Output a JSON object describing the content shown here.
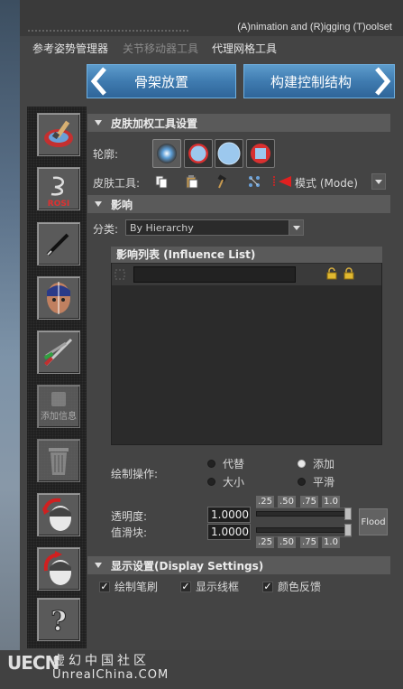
{
  "app": {
    "title": "(A)nimation and (R)igging (T)oolset"
  },
  "menu": {
    "items": [
      {
        "label": "参考姿势管理器",
        "enabled": true
      },
      {
        "label": "关节移动器工具",
        "enabled": false
      },
      {
        "label": "代理网格工具",
        "enabled": true
      }
    ]
  },
  "nav": {
    "prev_label": "骨架放置",
    "next_label": "构建控制结构",
    "accent": "#4a8ac0"
  },
  "tools": [
    {
      "icon": "skin-paint-icon",
      "caption": ""
    },
    {
      "icon": "rosi-icon",
      "caption": ""
    },
    {
      "icon": "pencil-icon",
      "caption": ""
    },
    {
      "icon": "mirror-face-icon",
      "caption": ""
    },
    {
      "icon": "scissors-icon",
      "caption": ""
    },
    {
      "icon": "add-info-icon",
      "caption": "添加信息"
    },
    {
      "icon": "trash-icon",
      "caption": ""
    },
    {
      "icon": "head-rotate-icon",
      "caption": ""
    },
    {
      "icon": "head-rotate-back-icon",
      "caption": ""
    },
    {
      "icon": "help-icon",
      "caption": ""
    }
  ],
  "skin_tools": {
    "header": "皮肤加权工具设置",
    "profile_label": "轮廓:",
    "skin_tools_label": "皮肤工具:",
    "mode_label": "模式 (Mode)"
  },
  "influence": {
    "header": "影响",
    "sort_label": "分类:",
    "sort_value": "By Hierarchy",
    "list_title": "影响列表 (Influence List)"
  },
  "paint_ops": {
    "label": "绘制操作:",
    "options": [
      {
        "label": "代替",
        "selected": false
      },
      {
        "label": "添加",
        "selected": true
      },
      {
        "label": "大小",
        "selected": false
      },
      {
        "label": "平滑",
        "selected": false
      }
    ]
  },
  "opacity": {
    "label": "透明度:",
    "value": "1.0000",
    "level": 1.0
  },
  "value": {
    "label": "值滑块:",
    "value": "1.0000",
    "level": 1.0
  },
  "presets": [
    ".25",
    ".50",
    ".75",
    "1.0"
  ],
  "flood_label": "Flood",
  "display": {
    "header": "显示设置(Display Settings)",
    "checks": [
      {
        "label": "绘制笔刷",
        "checked": true
      },
      {
        "label": "显示线框",
        "checked": true
      },
      {
        "label": "颜色反馈",
        "checked": true
      }
    ]
  },
  "footer": {
    "logo_mark": "UECN",
    "cn": "虚幻中国社区",
    "en": "UnrealChina.COM"
  }
}
